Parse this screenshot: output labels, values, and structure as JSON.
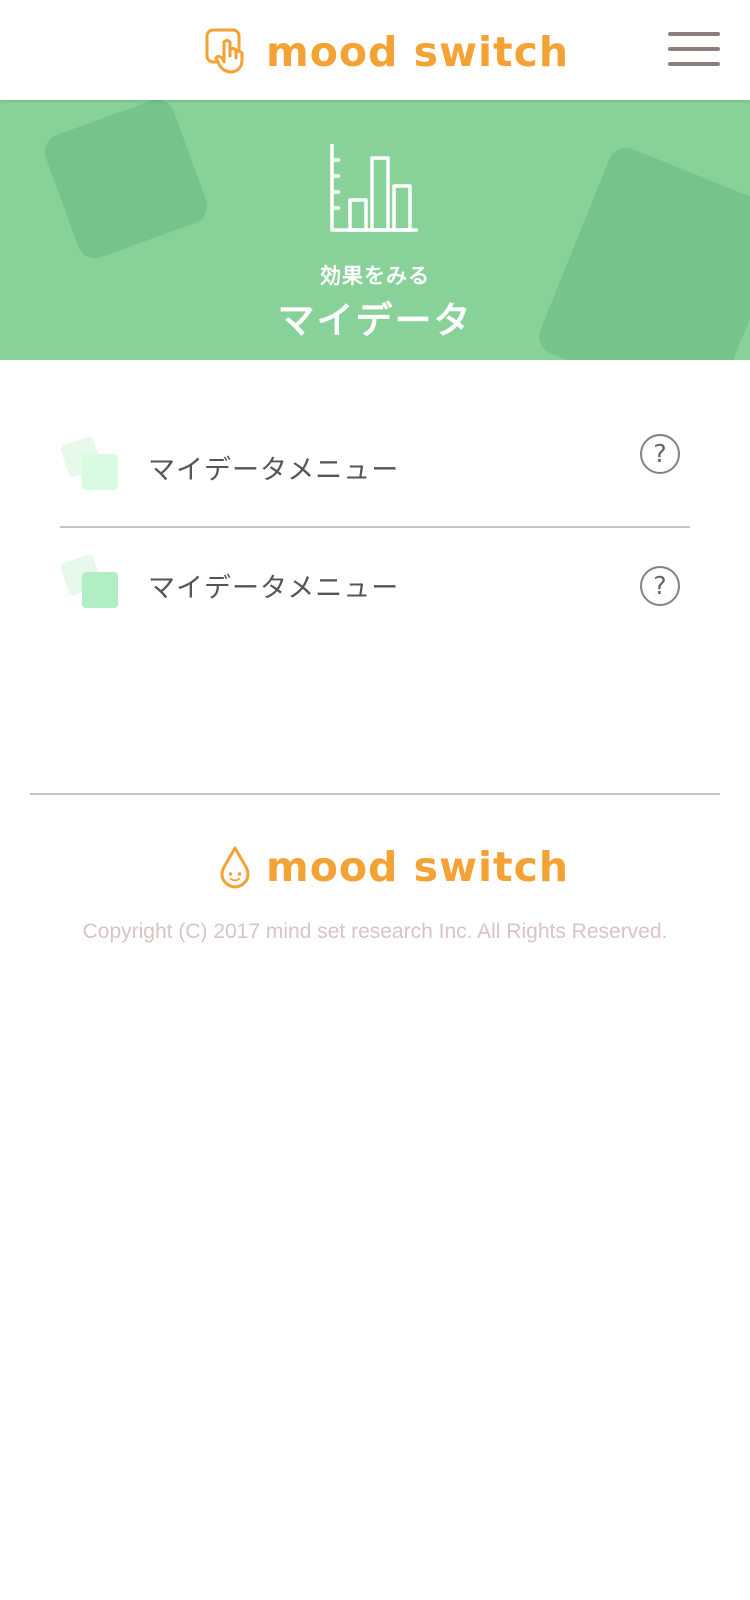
{
  "header": {
    "brand": "mood switch",
    "brand_icon": "hand-pointer-icon",
    "menu_icon": "hamburger-menu-icon"
  },
  "hero": {
    "icon": "bar-chart-icon",
    "subtitle": "効果をみる",
    "title": "マイデータ"
  },
  "menu": {
    "items": [
      {
        "label": "マイデータメニュー",
        "help": "?",
        "icon": "tile-stack-icon"
      },
      {
        "label": "マイデータメニュー",
        "help": "?",
        "icon": "tile-stack-icon"
      }
    ]
  },
  "footer": {
    "brand": "mood switch",
    "brand_icon": "drop-face-icon",
    "copyright": "Copyright (C) 2017 mind set research Inc. All Rights Reserved."
  },
  "colors": {
    "brand_orange": "#f5a234",
    "hero_green": "#88d29a",
    "hero_deco": "#76c38c",
    "menu_lines": "#8a7f7d",
    "tile_light": "#d8fbe2",
    "tile_mid": "#b2eec4",
    "tile_back": "#e6f9ea",
    "copyright": "#d9c3c5"
  }
}
